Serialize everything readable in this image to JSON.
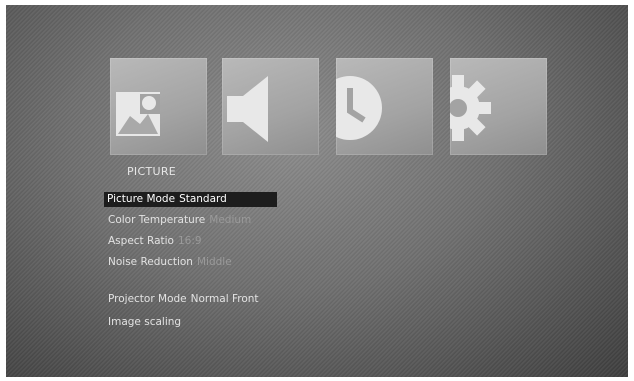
{
  "menu": {
    "icons": [
      {
        "name": "picture-icon"
      },
      {
        "name": "sound-icon"
      },
      {
        "name": "time-icon"
      },
      {
        "name": "setup-icon"
      }
    ],
    "section_title": "PICTURE",
    "items": [
      {
        "label": "Picture Mode",
        "value": "Standard",
        "selected": true
      },
      {
        "label": "Color Temperature",
        "value": "Medium"
      },
      {
        "label": "Aspect Ratio",
        "value": "16:9"
      },
      {
        "label": "Noise Reduction",
        "value": "Middle"
      },
      {
        "label": "Projector Mode",
        "value": "Normal Front"
      },
      {
        "label": "Image scaling",
        "value": ""
      }
    ]
  },
  "colors": {
    "background": "#6f6f6f",
    "tile": "#a8a8a8",
    "highlight": "#1d1d1d",
    "text": "#e2e2e2",
    "dim_value": "#9a9a9a"
  }
}
